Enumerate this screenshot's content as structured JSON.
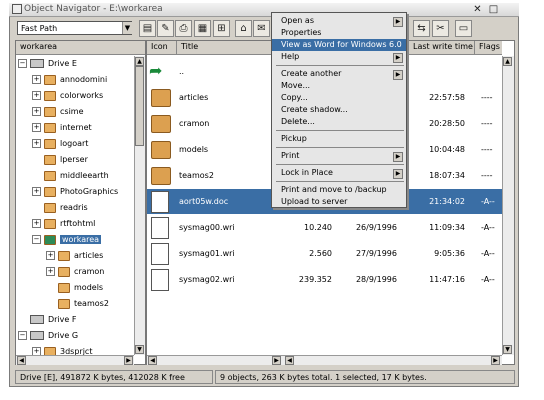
{
  "window": {
    "title": "Object Navigator - E:\\workarea",
    "close_glyph": "✕",
    "max_glyph": "□"
  },
  "toolbar": {
    "path_value": "Fast Path",
    "combo_arrow": "▼",
    "tool_glyphs": [
      "▤",
      "✎",
      "⎙",
      "▦",
      "⊞",
      "⌂",
      "✉",
      "⚙",
      "⇆",
      "✂",
      "▭"
    ]
  },
  "tree": {
    "header": "workarea",
    "items": [
      {
        "label": "Drive E",
        "kind": "drive",
        "expander": "−"
      },
      {
        "label": "annodomini",
        "kind": "folder",
        "expander": "+"
      },
      {
        "label": "colorworks",
        "kind": "folder",
        "expander": "+"
      },
      {
        "label": "csime",
        "kind": "folder",
        "expander": "+"
      },
      {
        "label": "internet",
        "kind": "folder",
        "expander": "+"
      },
      {
        "label": "logoart",
        "kind": "folder",
        "expander": "+"
      },
      {
        "label": "lperser",
        "kind": "folder",
        "expander": ""
      },
      {
        "label": "middleearth",
        "kind": "folder",
        "expander": ""
      },
      {
        "label": "PhotoGraphics",
        "kind": "folder",
        "expander": "+"
      },
      {
        "label": "readris",
        "kind": "folder",
        "expander": ""
      },
      {
        "label": "rtftohtml",
        "kind": "folder",
        "expander": "+"
      },
      {
        "label": "workarea",
        "kind": "open-folder",
        "expander": "−",
        "selected": true
      },
      {
        "label": "articles",
        "kind": "folder",
        "expander": "+"
      },
      {
        "label": "cramon",
        "kind": "folder",
        "expander": "+"
      },
      {
        "label": "models",
        "kind": "folder",
        "expander": ""
      },
      {
        "label": "teamos2",
        "kind": "folder",
        "expander": ""
      },
      {
        "label": "Drive F",
        "kind": "drive",
        "expander": ""
      },
      {
        "label": "Drive G",
        "kind": "drive",
        "expander": "−"
      },
      {
        "label": "3dsprjct",
        "kind": "folder",
        "expander": "+"
      }
    ]
  },
  "list": {
    "headers": {
      "icon": "Icon",
      "title": "Title",
      "size": "",
      "date": "",
      "time": "Last write time",
      "flags": "Flags"
    },
    "rows": [
      {
        "icon": "arrow",
        "title": "..",
        "size": "",
        "date": "",
        "time": "",
        "flags": ""
      },
      {
        "icon": "folder",
        "title": "articles",
        "size": "",
        "date": "",
        "time": "22:57:58",
        "flags": "----"
      },
      {
        "icon": "folder",
        "title": "cramon",
        "size": "",
        "date": "",
        "time": "20:28:50",
        "flags": "----"
      },
      {
        "icon": "folder",
        "title": "models",
        "size": "",
        "date": "",
        "time": "10:04:48",
        "flags": "----"
      },
      {
        "icon": "folder",
        "title": "teamos2",
        "size": "",
        "date": "",
        "time": "18:07:34",
        "flags": "----"
      },
      {
        "icon": "doc",
        "title": "aort05w.doc",
        "size": "",
        "date": "",
        "time": "21:34:02",
        "flags": "-A--",
        "selected": true
      },
      {
        "icon": "doc",
        "title": "sysmag00.wri",
        "size": "10.240",
        "date": "26/9/1996",
        "time": "11:09:34",
        "flags": "-A--"
      },
      {
        "icon": "doc",
        "title": "sysmag01.wri",
        "size": "2.560",
        "date": "27/9/1996",
        "time": "9:05:36",
        "flags": "-A--"
      },
      {
        "icon": "doc",
        "title": "sysmag02.wri",
        "size": "239.352",
        "date": "28/9/1996",
        "time": "11:47:16",
        "flags": "-A--"
      }
    ]
  },
  "status": {
    "left": "Drive [E], 491872 K bytes, 412028 K free",
    "right": "9 objects, 263 K bytes total. 1 selected, 17 K bytes."
  },
  "context_menu": {
    "items": [
      {
        "label": "Open as",
        "submenu": true
      },
      {
        "label": "Properties"
      },
      {
        "label": "View as Word for Windows 6.0",
        "highlighted": true
      },
      {
        "label": "Help",
        "submenu": true
      },
      {
        "sep": true
      },
      {
        "label": "Create another",
        "submenu": true
      },
      {
        "label": "Move..."
      },
      {
        "label": "Copy..."
      },
      {
        "label": "Create shadow..."
      },
      {
        "label": "Delete..."
      },
      {
        "sep": true
      },
      {
        "label": "Pickup"
      },
      {
        "sep": true
      },
      {
        "label": "Print",
        "submenu": true
      },
      {
        "sep": true
      },
      {
        "label": "Lock in Place",
        "submenu": true
      },
      {
        "sep": true
      },
      {
        "label": "Print and move to /backup"
      },
      {
        "label": "Upload to server"
      }
    ],
    "submenu_glyph": "▶"
  },
  "scroll_glyphs": {
    "up": "▲",
    "down": "▼",
    "left": "◀",
    "right": "▶"
  },
  "colors": {
    "selection": "#3a6ea5",
    "folder": "#dca050",
    "window_bg": "#d4d0c8"
  }
}
